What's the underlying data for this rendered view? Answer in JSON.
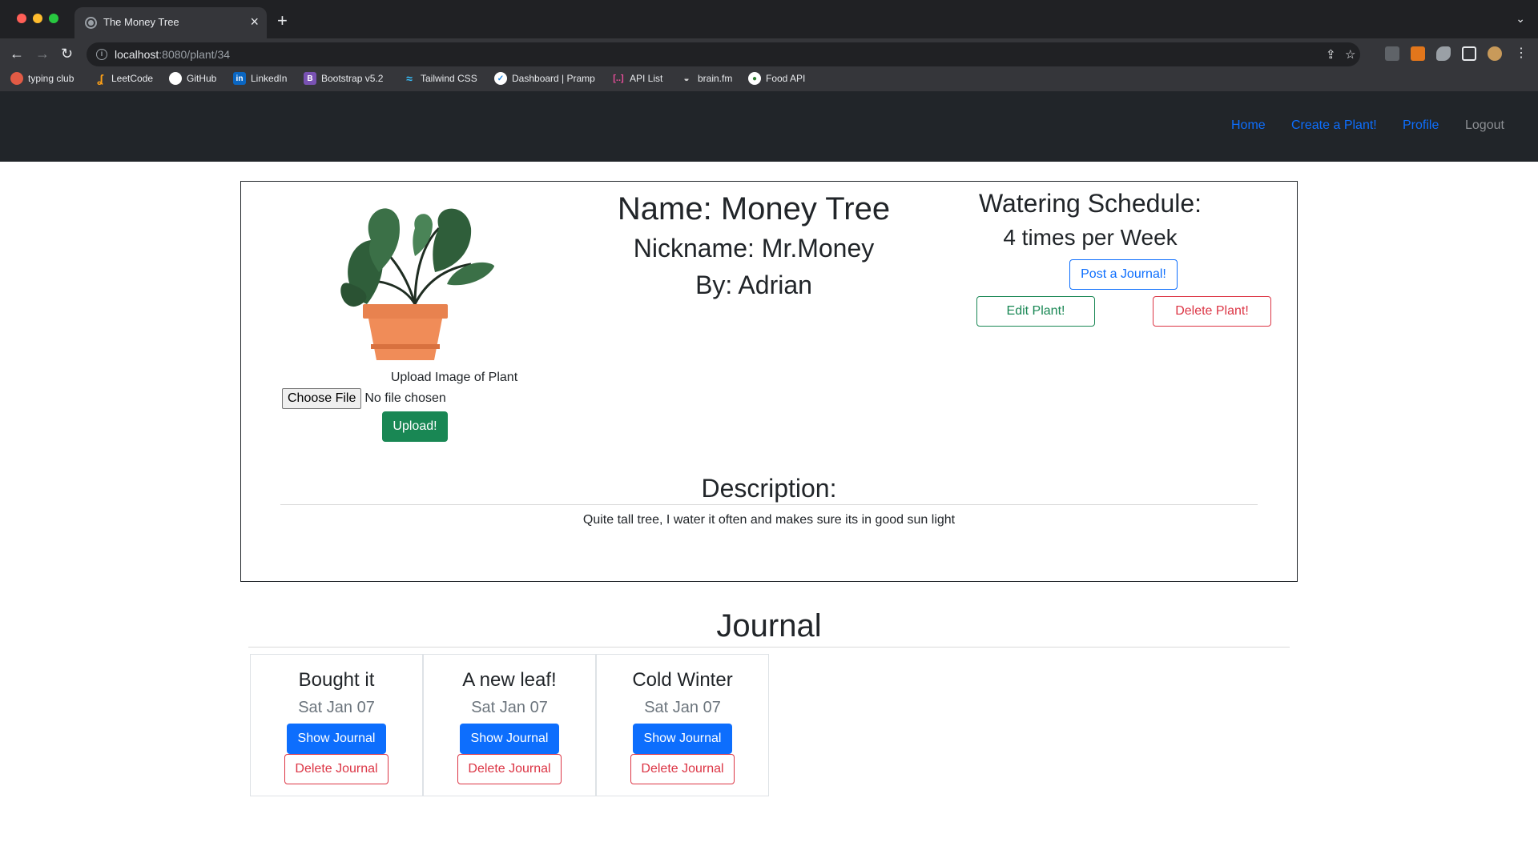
{
  "browser": {
    "tab_title": "The Money Tree",
    "new_tab_symbol": "+",
    "url_host": "localhost",
    "url_path": ":8080/plant/34",
    "bookmarks": [
      {
        "label": "typing club",
        "icon": "typing-club-icon",
        "color": "#e25b45"
      },
      {
        "label": "LeetCode",
        "icon": "leetcode-icon",
        "color": "#ffa116"
      },
      {
        "label": "GitHub",
        "icon": "github-icon",
        "color": "#ffffff"
      },
      {
        "label": "LinkedIn",
        "icon": "linkedin-icon",
        "color": "#0a66c2"
      },
      {
        "label": "Bootstrap v5.2",
        "icon": "bootstrap-icon",
        "color": "#7952b3"
      },
      {
        "label": "Tailwind CSS",
        "icon": "tailwind-icon",
        "color": "#38bdf8"
      },
      {
        "label": "Dashboard | Pramp",
        "icon": "pramp-icon",
        "color": "#ffffff"
      },
      {
        "label": "API List",
        "icon": "api-list-icon",
        "color": "#e94e9a"
      },
      {
        "label": "brain.fm",
        "icon": "brainfm-icon",
        "color": "#cfcfcf"
      },
      {
        "label": "Food API",
        "icon": "food-api-icon",
        "color": "#ffffff"
      }
    ]
  },
  "nav": {
    "home": "Home",
    "create": "Create a Plant!",
    "profile": "Profile",
    "logout": "Logout"
  },
  "plant": {
    "name": "Name: Money Tree",
    "nickname": "Nickname: Mr.Money",
    "by": "By: Adrian",
    "upload_label": "Upload Image of Plant",
    "choose_file": "Choose File",
    "no_file": "No file chosen",
    "upload_button": "Upload!",
    "watering_title": "Watering Schedule:",
    "watering_value": "4 times per Week",
    "post_journal": "Post a Journal!",
    "edit_plant": "Edit Plant!",
    "delete_plant": "Delete Plant!",
    "description_title": "Description:",
    "description": "Quite tall tree, I water it often and makes sure its in good sun light"
  },
  "journal": {
    "title": "Journal",
    "entries": [
      {
        "title": "Bought it",
        "date": "Sat Jan 07",
        "show": "Show Journal",
        "delete": "Delete Journal"
      },
      {
        "title": "A new leaf!",
        "date": "Sat Jan 07",
        "show": "Show Journal",
        "delete": "Delete Journal"
      },
      {
        "title": "Cold Winter",
        "date": "Sat Jan 07",
        "show": "Show Journal",
        "delete": "Delete Journal"
      }
    ]
  },
  "colors": {
    "primary": "#0d6efd",
    "success": "#198754",
    "danger": "#dc3545",
    "navbar": "#212529"
  }
}
